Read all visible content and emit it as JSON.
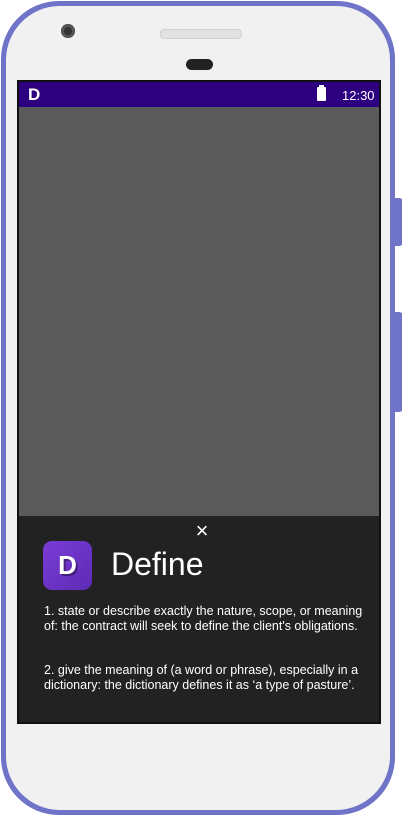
{
  "status_bar": {
    "app_indicator": "D",
    "time": "12:30"
  },
  "sheet": {
    "close_icon": "×",
    "app_icon_letter": "D",
    "title": "Define",
    "definitions": [
      "1. state or describe exactly the nature, scope, or meaning of: the contract will seek to define the client's obligations.",
      "2. give the meaning of (a word or phrase), especially in a dictionary: the dictionary defines it as ‘a type of pasture’."
    ]
  },
  "colors": {
    "phone_frame": "#6f74c8",
    "status_bar": "#2d0080",
    "sheet_background": "#222222",
    "app_icon": "#6a32c4",
    "dim_overlay": "#5a5a5a"
  },
  "icons": {
    "close": "close-icon",
    "battery": "battery-icon",
    "app": "define-app-icon"
  }
}
